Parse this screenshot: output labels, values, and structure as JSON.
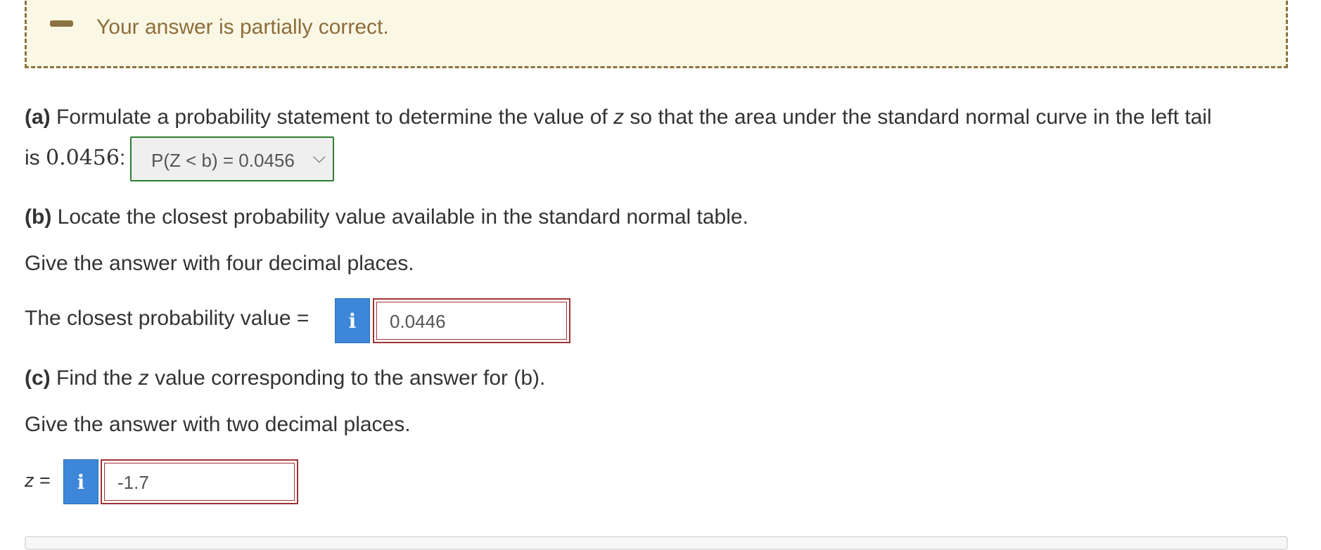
{
  "feedback": {
    "message": "Your answer is partially correct."
  },
  "part_a": {
    "label": "(a)",
    "text_before_z": " Formulate a probability statement to determine the value of ",
    "z_var": "z",
    "text_after_z": " so that the area under the standard normal curve in the left tail",
    "line2_prefix": "is ",
    "value": "0.0456",
    "colon": ":",
    "selected_option": "P(Z < b) = 0.0456"
  },
  "part_b": {
    "label": "(b)",
    "text": " Locate the closest probability value available in the standard normal table.",
    "instruction": "Give the answer with four decimal places.",
    "prompt": "The closest probability value =",
    "info_icon": "i",
    "answer": "0.0446"
  },
  "part_c": {
    "label": "(c)",
    "text_before_z": " Find the ",
    "z_var": "z",
    "text_after_z": " value corresponding to the answer for (b).",
    "instruction": "Give the answer with two decimal places.",
    "prompt_var": "z",
    "prompt_eq": " =",
    "info_icon": "i",
    "answer": "-1.7"
  },
  "colors": {
    "feedback_bg": "#fbf7e5",
    "feedback_accent": "#8c7240",
    "incorrect_border": "#a23333",
    "correct_border": "#2e7d32",
    "info_button": "#3d86d9"
  }
}
